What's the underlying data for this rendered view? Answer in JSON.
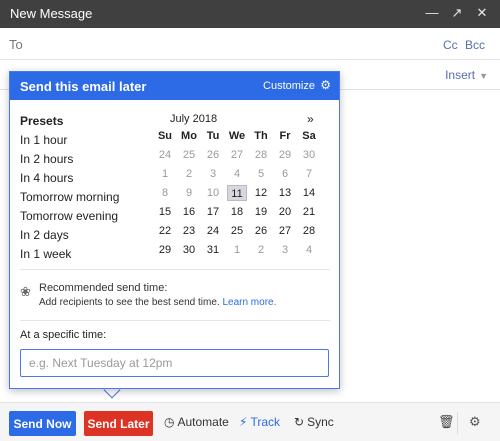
{
  "window": {
    "title": "New Message"
  },
  "header": {
    "to_label": "To",
    "cc": "Cc",
    "bcc": "Bcc",
    "insert": "Insert"
  },
  "popup": {
    "title": "Send this email later",
    "customize": "Customize",
    "presets_title": "Presets",
    "presets": [
      "In 1 hour",
      "In 2 hours",
      "In 4 hours",
      "Tomorrow morning",
      "Tomorrow evening",
      "In 2 days",
      "In 1 week"
    ],
    "calendar": {
      "month": "July 2018",
      "next": "»",
      "weekdays": [
        "Su",
        "Mo",
        "Tu",
        "We",
        "Th",
        "Fr",
        "Sa"
      ],
      "weeks": [
        [
          [
            "24",
            0
          ],
          [
            "25",
            0
          ],
          [
            "26",
            0
          ],
          [
            "27",
            0
          ],
          [
            "28",
            0
          ],
          [
            "29",
            0
          ],
          [
            "30",
            0
          ]
        ],
        [
          [
            "1",
            0
          ],
          [
            "2",
            0
          ],
          [
            "3",
            0
          ],
          [
            "4",
            0
          ],
          [
            "5",
            0
          ],
          [
            "6",
            0
          ],
          [
            "7",
            0
          ]
        ],
        [
          [
            "8",
            0
          ],
          [
            "9",
            0
          ],
          [
            "10",
            0
          ],
          [
            "11",
            2
          ],
          [
            "12",
            1
          ],
          [
            "13",
            1
          ],
          [
            "14",
            1
          ]
        ],
        [
          [
            "15",
            1
          ],
          [
            "16",
            1
          ],
          [
            "17",
            1
          ],
          [
            "18",
            1
          ],
          [
            "19",
            1
          ],
          [
            "20",
            1
          ],
          [
            "21",
            1
          ]
        ],
        [
          [
            "22",
            1
          ],
          [
            "23",
            1
          ],
          [
            "24",
            1
          ],
          [
            "25",
            1
          ],
          [
            "26",
            1
          ],
          [
            "27",
            1
          ],
          [
            "28",
            1
          ]
        ],
        [
          [
            "29",
            1
          ],
          [
            "30",
            1
          ],
          [
            "31",
            1
          ],
          [
            "1",
            0
          ],
          [
            "2",
            0
          ],
          [
            "3",
            0
          ],
          [
            "4",
            0
          ]
        ]
      ]
    },
    "recommended_title": "Recommended send time:",
    "recommended_text": "Add recipients to see the best send time.",
    "recommended_link": "Learn more.",
    "specific_label": "At a specific time:",
    "time_placeholder": "e.g. Next Tuesday at 12pm"
  },
  "toolbar": {
    "send_now": "Send Now",
    "send_later": "Send Later",
    "automate": "Automate",
    "track": "Track",
    "sync": "Sync"
  },
  "colors": {
    "accent": "#2c6ae6",
    "send_later": "#dd3324",
    "titlebar": "#404040"
  }
}
